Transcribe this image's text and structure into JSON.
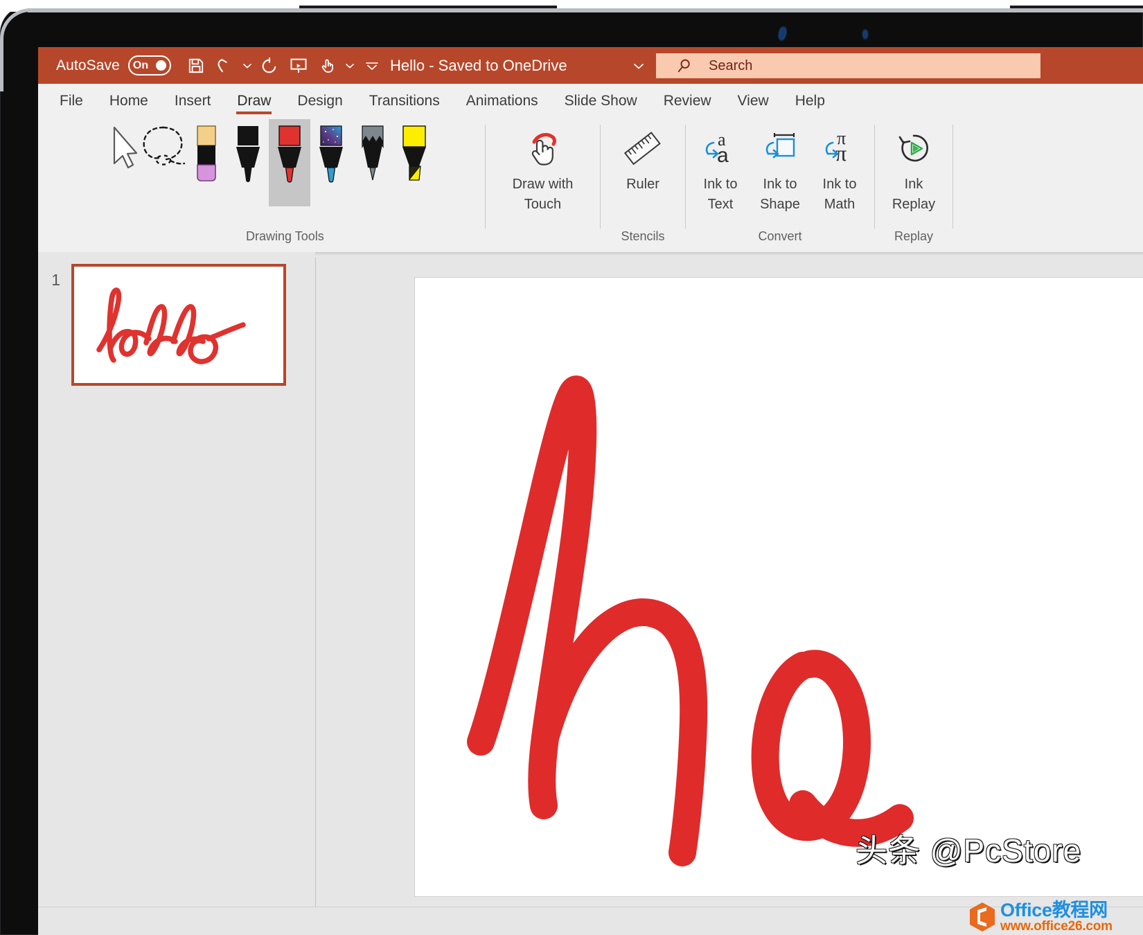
{
  "window": {
    "titlebar": {
      "autosave_label": "AutoSave",
      "autosave_state": "On",
      "document_title": "Hello - Saved to OneDrive",
      "quick_access": [
        {
          "name": "save-icon",
          "tooltip": "Save"
        },
        {
          "name": "undo-icon",
          "tooltip": "Undo"
        },
        {
          "name": "undo-dropdown-caret-icon",
          "tooltip": "Undo options"
        },
        {
          "name": "redo-icon",
          "tooltip": "Redo"
        },
        {
          "name": "start-presentation-icon",
          "tooltip": "Start from Beginning"
        },
        {
          "name": "touch-mode-icon",
          "tooltip": "Touch/Mouse Mode"
        },
        {
          "name": "touch-dropdown-caret-icon",
          "tooltip": "Touch options"
        },
        {
          "name": "customize-qat-caret-icon",
          "tooltip": "Customize Quick Access Toolbar"
        }
      ],
      "title_caret": "chevron-down-icon",
      "accent_color": "#B7472A"
    },
    "search": {
      "placeholder": "Search",
      "icon": "search-icon",
      "background": "#F9C9B0"
    }
  },
  "ribbon": {
    "tabs": [
      {
        "label": "File",
        "active": false
      },
      {
        "label": "Home",
        "active": false
      },
      {
        "label": "Insert",
        "active": false
      },
      {
        "label": "Draw",
        "active": true
      },
      {
        "label": "Design",
        "active": false
      },
      {
        "label": "Transitions",
        "active": false
      },
      {
        "label": "Animations",
        "active": false
      },
      {
        "label": "Slide Show",
        "active": false
      },
      {
        "label": "Review",
        "active": false
      },
      {
        "label": "View",
        "active": false
      },
      {
        "label": "Help",
        "active": false
      }
    ],
    "groups": [
      {
        "label": "Drawing Tools",
        "tools": [
          {
            "name": "select-cursor-tool",
            "selected": false
          },
          {
            "name": "lasso-select-tool",
            "selected": false
          },
          {
            "name": "eraser-tool",
            "selected": false
          },
          {
            "name": "pen-black-tool",
            "selected": false
          },
          {
            "name": "pen-red-tool",
            "selected": true
          },
          {
            "name": "pen-galaxy-tool",
            "selected": false
          },
          {
            "name": "pencil-gray-tool",
            "selected": false
          },
          {
            "name": "highlighter-yellow-tool",
            "selected": false
          }
        ]
      },
      {
        "label": "",
        "buttons": [
          {
            "name": "draw-with-touch-button",
            "label_line1": "Draw with",
            "label_line2": "Touch",
            "icon": "touch-draw-icon"
          }
        ]
      },
      {
        "label": "Stencils",
        "buttons": [
          {
            "name": "ruler-button",
            "label_line1": "Ruler",
            "label_line2": "",
            "icon": "ruler-icon"
          }
        ]
      },
      {
        "label": "Convert",
        "buttons": [
          {
            "name": "ink-to-text-button",
            "label_line1": "Ink to",
            "label_line2": "Text",
            "icon": "ink-to-text-icon"
          },
          {
            "name": "ink-to-shape-button",
            "label_line1": "Ink to",
            "label_line2": "Shape",
            "icon": "ink-to-shape-icon"
          },
          {
            "name": "ink-to-math-button",
            "label_line1": "Ink to",
            "label_line2": "Math",
            "icon": "ink-to-math-icon"
          }
        ]
      },
      {
        "label": "Replay",
        "buttons": [
          {
            "name": "ink-replay-button",
            "label_line1": "Ink",
            "label_line2": "Replay",
            "icon": "ink-replay-icon"
          }
        ]
      }
    ]
  },
  "slides_pane": {
    "slides": [
      {
        "number": "1",
        "selected": true,
        "ink_text": "hello"
      }
    ]
  },
  "canvas": {
    "ink_text": "hello",
    "ink_color": "#E02B2B"
  },
  "watermarks": {
    "headline": "头条 @PcStore",
    "badge_line1": "Office教程网",
    "badge_line2": "www.office26.com",
    "badge_icon": "office-logo-icon"
  }
}
